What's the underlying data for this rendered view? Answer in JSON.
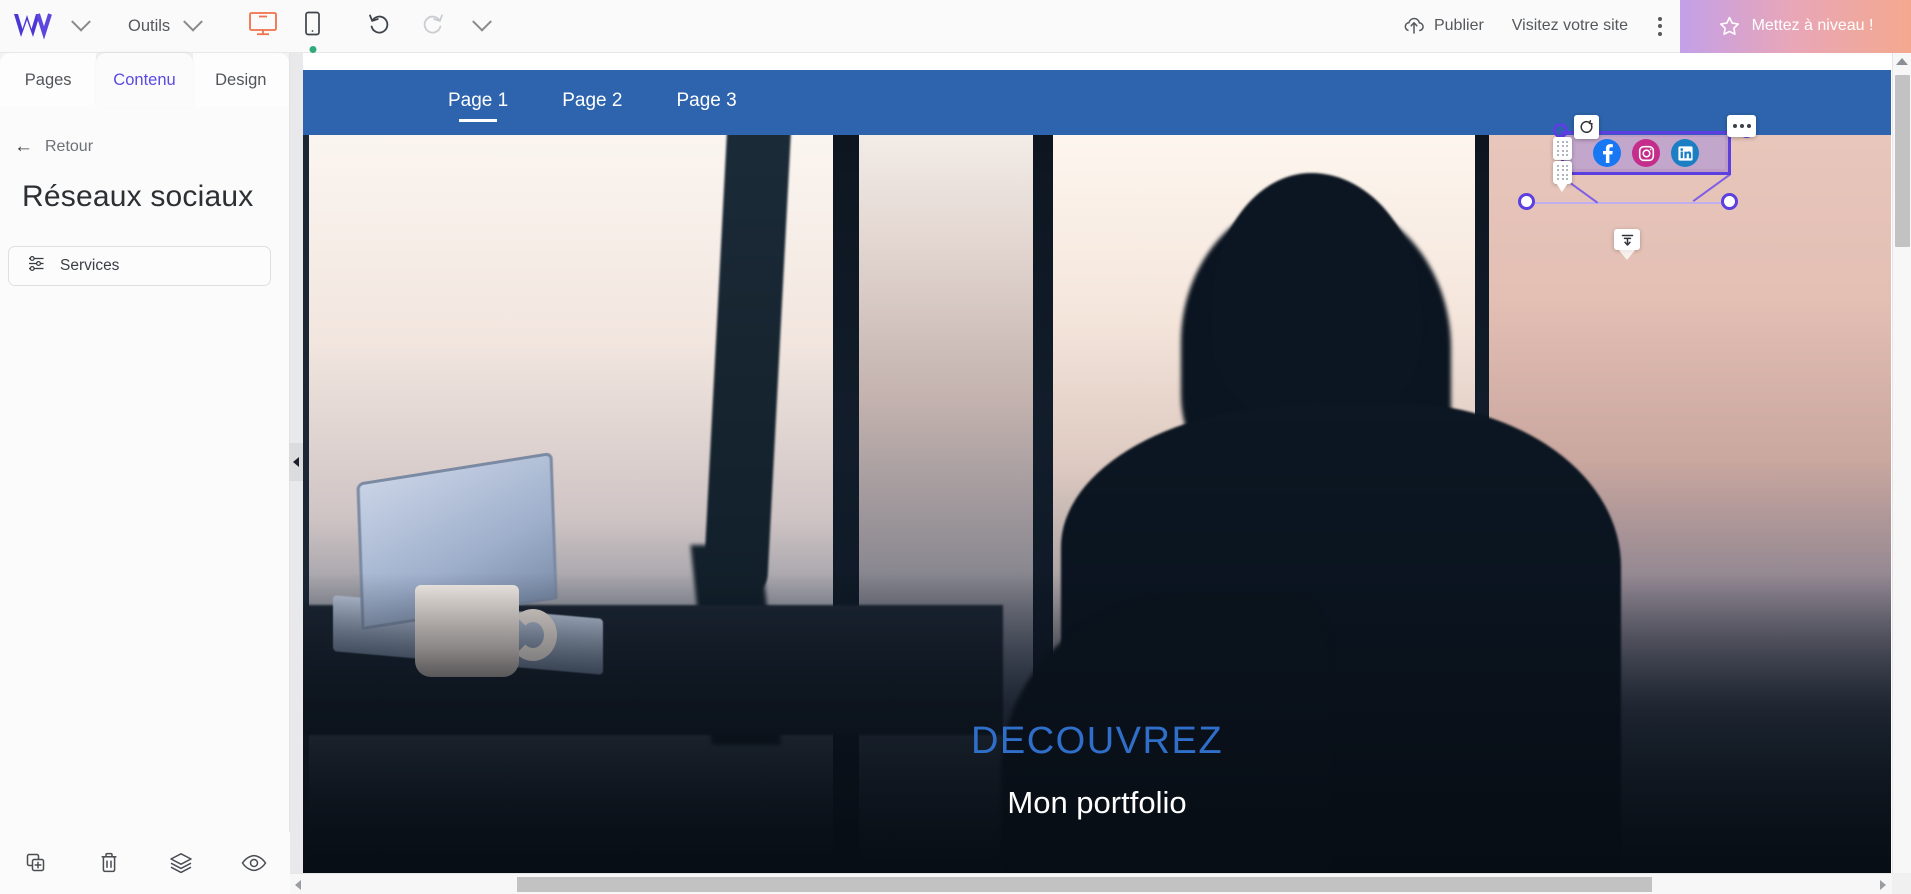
{
  "toolbar": {
    "logo_name": "wix-logo",
    "logo_caret": "chevron-down",
    "tools_label": "Outils",
    "devices": [
      {
        "name": "desktop-view",
        "icon": "monitor-icon",
        "active": true
      },
      {
        "name": "mobile-view",
        "icon": "phone-icon",
        "active": false,
        "dot": true
      }
    ],
    "undo_label": "undo-icon",
    "redo_label": "redo-icon",
    "history_caret": "chevron-down",
    "publish_label": "Publier",
    "publish_icon": "upload-cloud-icon",
    "visit_label": "Visitez votre site",
    "more_label": "kebab-menu",
    "upgrade_label": "Mettez à niveau !",
    "upgrade_icon": "star-icon",
    "upgrade_gradient_start": "#c3a0e8",
    "upgrade_gradient_end": "#f4a98e"
  },
  "left_panel": {
    "tabs": [
      {
        "label": "Pages",
        "active": false
      },
      {
        "label": "Contenu",
        "active": true
      },
      {
        "label": "Design",
        "active": false
      }
    ],
    "active_tab_color": "#5a4ae3",
    "back_label": "Retour",
    "title": "Réseaux sociaux",
    "items": [
      {
        "label": "Services",
        "icon": "sliders-icon"
      }
    ],
    "footer_tools": [
      {
        "name": "duplicate-icon",
        "label": "Dupliquer"
      },
      {
        "name": "trash-icon",
        "label": "Supprimer"
      },
      {
        "name": "layers-icon",
        "label": "Calques"
      },
      {
        "name": "eye-icon",
        "label": "Aperçu"
      }
    ],
    "collapse_label": "collapse-panel"
  },
  "site": {
    "nav_bg": "#2d64ad",
    "nav_items": [
      {
        "label": "Page 1",
        "active": true
      },
      {
        "label": "Page 2",
        "active": false
      },
      {
        "label": "Page 3",
        "active": false
      }
    ],
    "hero": {
      "heading": "DECOUVREZ",
      "heading_color": "#2f6fc9",
      "subheading": "Mon portfolio",
      "subheading_color": "#ffffff"
    }
  },
  "selection": {
    "element_name": "social-bar-widget",
    "border_color": "#5b3fe0",
    "socials": [
      {
        "name": "facebook-icon",
        "glyph": "f",
        "color": "#1877f2"
      },
      {
        "name": "instagram-icon",
        "glyph": "◉",
        "color": "#c42d8b"
      },
      {
        "name": "linkedin-icon",
        "glyph": "in",
        "color": "#1c7fc4"
      }
    ],
    "controls": [
      {
        "name": "rotate-handle",
        "icon": "rotate-icon"
      },
      {
        "name": "more-options-button",
        "icon": "ellipsis-icon"
      },
      {
        "name": "drag-handle-top",
        "icon": "grip-icon"
      },
      {
        "name": "drag-handle-bottom",
        "icon": "grip-icon"
      },
      {
        "name": "align-bottom-button",
        "icon": "align-down-icon"
      }
    ]
  },
  "scroll": {
    "vertical_name": "canvas-vertical-scrollbar",
    "horizontal_name": "canvas-horizontal-scrollbar"
  }
}
